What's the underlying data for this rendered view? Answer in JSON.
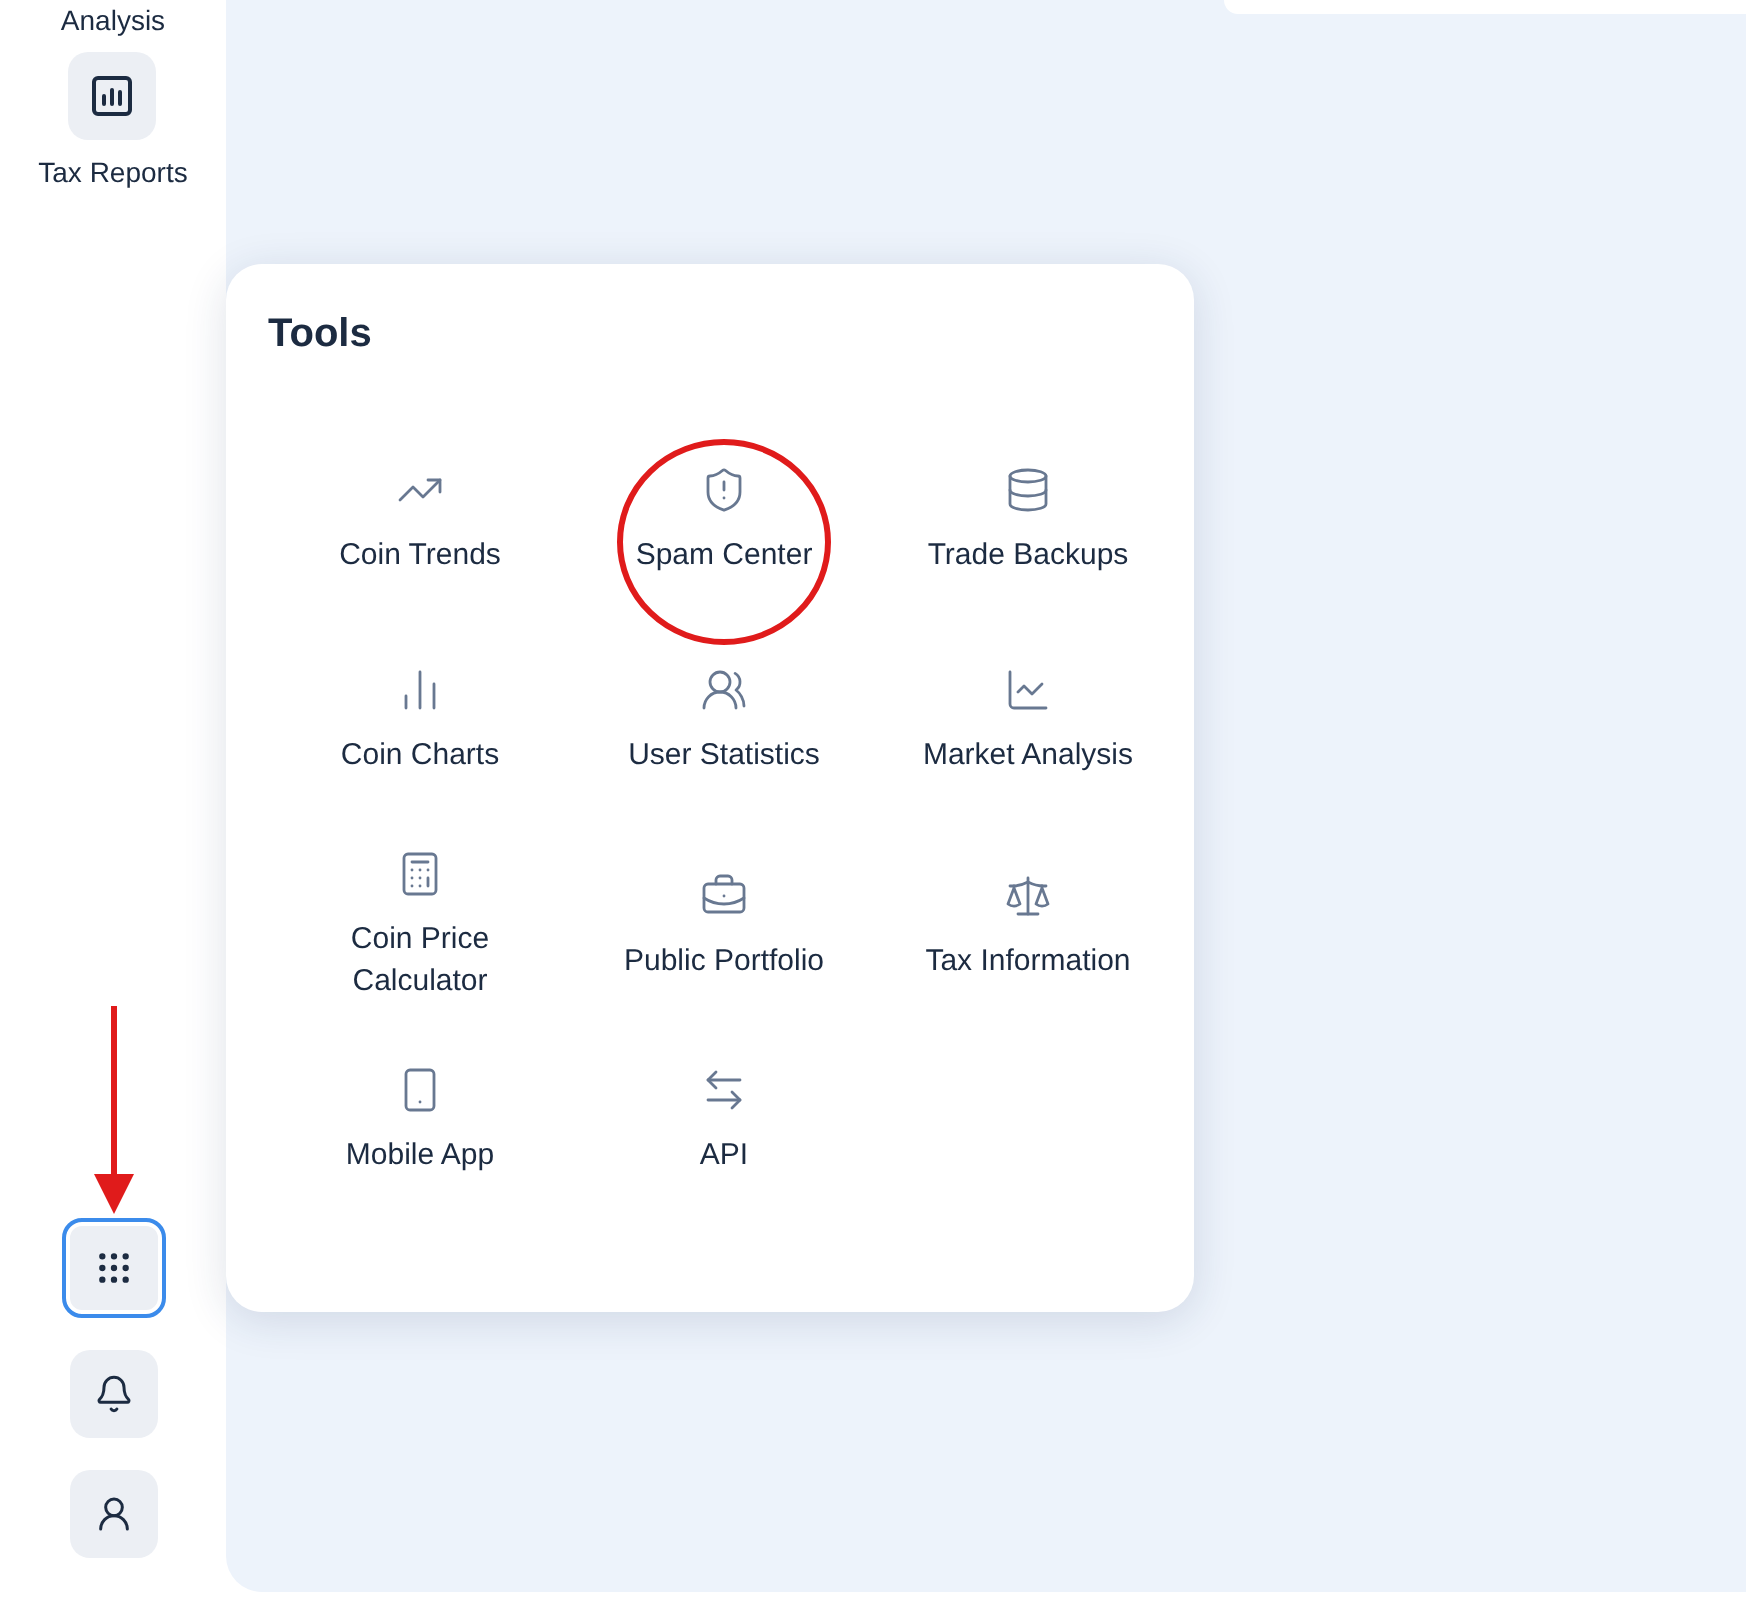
{
  "sidebar": {
    "items": [
      {
        "label": "Analysis",
        "kind": "text"
      },
      {
        "label": "Tax Reports",
        "kind": "icon"
      }
    ],
    "bottom_buttons": [
      {
        "selected": true,
        "pointed": true
      },
      {
        "selected": false,
        "pointed": false
      },
      {
        "selected": false,
        "pointed": false
      }
    ]
  },
  "tools": {
    "title": "Tools",
    "items": [
      {
        "label": "Coin Trends",
        "highlighted": false
      },
      {
        "label": "Spam Center",
        "highlighted": true
      },
      {
        "label": "Trade Backups",
        "highlighted": false
      },
      {
        "label": "Coin Charts",
        "highlighted": false
      },
      {
        "label": "User Statistics",
        "highlighted": false
      },
      {
        "label": "Market Analysis",
        "highlighted": false
      },
      {
        "label": "Coin Price Calculator",
        "highlighted": false
      },
      {
        "label": "Public Portfolio",
        "highlighted": false
      },
      {
        "label": "Tax Information",
        "highlighted": false
      },
      {
        "label": "Mobile App",
        "highlighted": false
      },
      {
        "label": "API",
        "highlighted": false
      }
    ]
  }
}
